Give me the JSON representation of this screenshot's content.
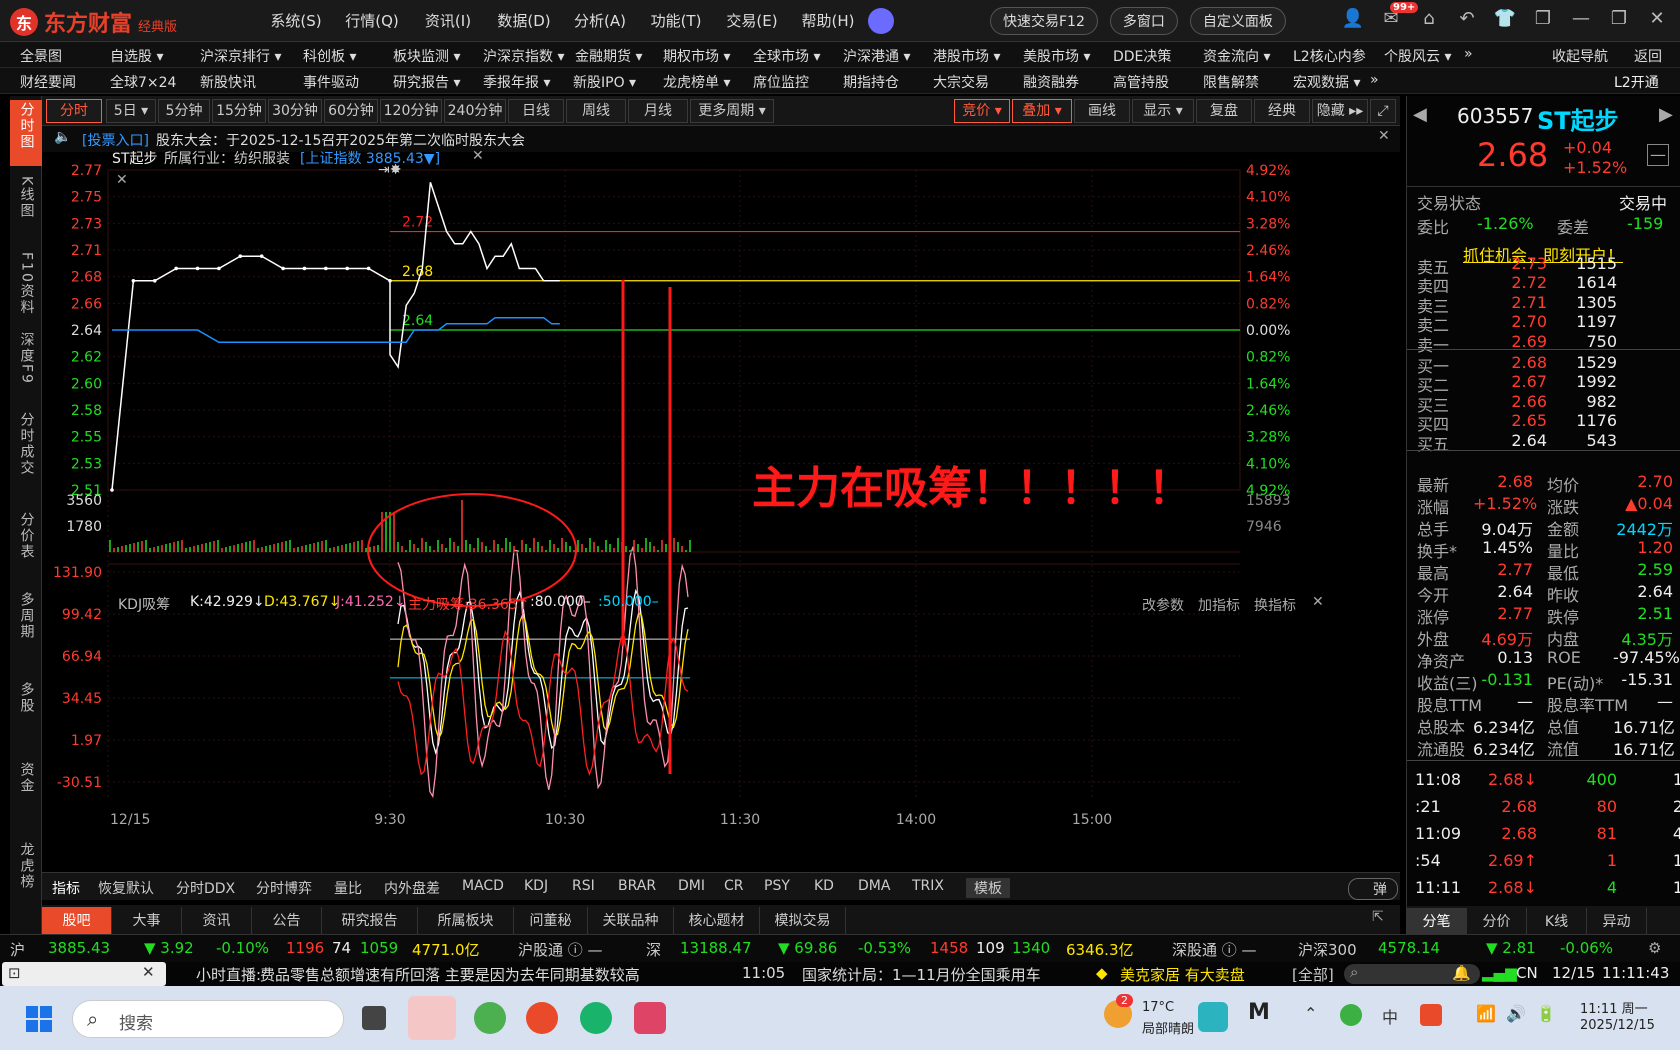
{
  "app": {
    "logo": "东方财富",
    "edition": "经典版"
  },
  "menu": [
    "系统(S)",
    "行情(Q)",
    "资讯(I)",
    "数据(D)",
    "分析(A)",
    "功能(T)",
    "交易(E)",
    "帮助(H)"
  ],
  "title_tools": [
    "快速交易F12",
    "多窗口",
    "自定义面板"
  ],
  "mail_badge": "99+",
  "nav1": [
    "全景图",
    "自选股 ▾",
    "沪深京排行 ▾",
    "科创板 ▾",
    "板块监测 ▾",
    "沪深京指数 ▾",
    "金融期货 ▾",
    "期权市场 ▾",
    "全球市场 ▾",
    "沪深港通 ▾",
    "港股市场 ▾",
    "美股市场 ▾",
    "DDE决策",
    "资金流向 ▾",
    "L2核心内参",
    "个股风云 ▾",
    "»",
    "收起导航",
    "返回"
  ],
  "nav2": [
    "财经要闻",
    "全球7×24",
    "新股快讯",
    "事件驱动",
    "研究报告 ▾",
    "季报年报 ▾",
    "新股IPO ▾",
    "龙虎榜单 ▾",
    "席位监控",
    "期指持仓",
    "大宗交易",
    "融资融券",
    "高管持股",
    "限售解禁",
    "宏观数据 ▾",
    "»",
    "L2开通"
  ],
  "leftbar": [
    "分时图",
    "K线图",
    "F10资料",
    "深度F9",
    "分时成交",
    "分价表",
    "多周期",
    "多股",
    "资金",
    "龙虎榜"
  ],
  "periods": [
    "分时",
    "5日 ▾",
    "5分钟",
    "15分钟",
    "30分钟",
    "60分钟",
    "120分钟",
    "240分钟",
    "日线",
    "周线",
    "月线",
    "更多周期 ▾"
  ],
  "chart_tools": [
    "竞价 ▾",
    "叠加 ▾",
    "画线",
    "显示 ▾",
    "复盘",
    "经典",
    "隐藏 ▸▸"
  ],
  "notice": {
    "link": "[投票入口]",
    "text": "股东大会：于2025-12-15召开2025年第二次临时股东大会"
  },
  "chart_head": {
    "name": "ST起步",
    "industry": "所属行业：纺织服装",
    "index": "[上证指数 3885.43▼]"
  },
  "kdj_head": {
    "name": "KDJ吸筹",
    "k": "K:42.929↓",
    "d": "D:43.767↓",
    "j": "J:41.252↓",
    "main": "主力吸筹:36.365↑",
    "l80": ":80.000–",
    "l50": ":50.000–"
  },
  "kdj_tools": [
    "改参数",
    "加指标",
    "换指标"
  ],
  "annotation": "主力在吸筹！！！！！",
  "chart_data": {
    "type": "line",
    "x_ticks": [
      "12/15",
      "9:30",
      "10:30",
      "11:30",
      "14:00",
      "15:00"
    ],
    "price_ticks": [
      "2.77",
      "2.75",
      "2.73",
      "2.71",
      "2.68",
      "2.66",
      "2.64",
      "2.62",
      "2.60",
      "2.58",
      "2.55",
      "2.53",
      "2.51"
    ],
    "pct_ticks": [
      "4.92%",
      "4.10%",
      "3.28%",
      "2.46%",
      "1.64%",
      "0.82%",
      "0.00%",
      "0.82%",
      "1.64%",
      "2.46%",
      "3.28%",
      "4.10%",
      "4.92%"
    ],
    "ylim": [
      2.51,
      2.77
    ],
    "prev_close": 2.64,
    "level_labels": [
      "2.72",
      "2.68",
      "2.64"
    ],
    "volume_ticks": [
      "3560",
      "1780"
    ],
    "volume_right": [
      "15893",
      "7946"
    ],
    "kdj_ticks": [
      "131.90",
      "99.42",
      "66.94",
      "34.45",
      "1.97",
      "-30.51"
    ],
    "series": [
      {
        "values": [
          2.51,
          2.68,
          2.68,
          2.69,
          2.69,
          2.69,
          2.7,
          2.7,
          2.69,
          2.69,
          2.69,
          2.69,
          2.69,
          2.68,
          2.62,
          2.61,
          2.66,
          2.67,
          2.69,
          2.76,
          2.74,
          2.72,
          2.71,
          2.71,
          2.72,
          2.71,
          2.69,
          2.7,
          2.7,
          2.71,
          2.69,
          2.69,
          2.69,
          2.68,
          2.68,
          2.68
        ]
      },
      {
        "values": [
          2.64,
          2.64,
          2.64,
          2.64,
          2.64,
          2.63,
          2.63,
          2.63,
          2.63,
          2.63,
          2.63,
          2.63,
          2.63,
          2.63,
          2.63,
          2.63,
          2.63,
          2.64,
          2.64,
          2.64,
          2.64,
          2.645,
          2.645,
          2.645,
          2.645,
          2.645,
          2.645,
          2.65,
          2.65,
          2.65,
          2.65,
          2.65,
          2.65,
          2.65,
          2.645,
          2.645
        ]
      }
    ]
  },
  "indicators": [
    "指标",
    "恢复默认",
    "分时DDX",
    "分时博弈",
    "量比",
    "内外盘差",
    "MACD",
    "KDJ",
    "RSI",
    "BRAR",
    "DMI",
    "CR",
    "PSY",
    "KD",
    "DMA",
    "TRIX",
    "模板"
  ],
  "popup_label": "弹",
  "bottom_tabs": [
    "股吧",
    "大事",
    "资讯",
    "公告",
    "研究报告",
    "所属板块",
    "问董秘",
    "关联品种",
    "核心题材",
    "模拟交易"
  ],
  "right_tabs": [
    "分笔",
    "分价",
    "K线",
    "异动"
  ],
  "quote": {
    "code": "603557",
    "name": "ST起步",
    "price": "2.68",
    "chg": "+0.04",
    "pct": "+1.52%",
    "status_label": "交易状态",
    "status": "交易中",
    "webi_label": "委比",
    "webi": "-1.26%",
    "weicha_label": "委差",
    "weicha": "-159",
    "promo": "抓住机会，即刻开户！",
    "asks": [
      [
        "卖五",
        "2.73",
        "1515"
      ],
      [
        "卖四",
        "2.72",
        "1614"
      ],
      [
        "卖三",
        "2.71",
        "1305"
      ],
      [
        "卖二",
        "2.70",
        "1197"
      ],
      [
        "卖一",
        "2.69",
        "750"
      ]
    ],
    "bids": [
      [
        "买一",
        "2.68",
        "1529"
      ],
      [
        "买二",
        "2.67",
        "1992"
      ],
      [
        "买三",
        "2.66",
        "982"
      ],
      [
        "买四",
        "2.65",
        "1176"
      ],
      [
        "买五",
        "2.64",
        "543"
      ]
    ],
    "stats": [
      [
        "最新",
        "2.68",
        "均价",
        "2.70"
      ],
      [
        "涨幅",
        "+1.52%",
        "涨跌",
        "▲0.04"
      ],
      [
        "总手",
        "9.04万",
        "金额",
        "2442万"
      ],
      [
        "换手*",
        "1.45%",
        "量比",
        "1.20"
      ],
      [
        "最高",
        "2.77",
        "最低",
        "2.59"
      ],
      [
        "今开",
        "2.64",
        "昨收",
        "2.64"
      ],
      [
        "涨停",
        "2.77",
        "跌停",
        "2.51"
      ],
      [
        "外盘",
        "4.69万",
        "内盘",
        "4.35万"
      ],
      [
        "净资产",
        "0.13",
        "ROE",
        "-97.45%"
      ],
      [
        "收益(三)",
        "-0.131",
        "PE(动)*",
        "-15.31"
      ],
      [
        "股息TTM",
        "—",
        "股息率TTM",
        "—"
      ],
      [
        "总股本",
        "6.234亿",
        "总值",
        "16.71亿"
      ],
      [
        "流通股",
        "6.234亿",
        "流值",
        "16.71亿"
      ]
    ],
    "ticks": [
      [
        "11:08",
        "2.68↓",
        "400",
        "1"
      ],
      [
        ":21",
        "2.68",
        "80",
        "2"
      ],
      [
        "11:09",
        "2.68",
        "81",
        "4"
      ],
      [
        ":54",
        "2.69↑",
        "1",
        "1"
      ],
      [
        "11:11",
        "2.68↓",
        "4",
        "1"
      ]
    ]
  },
  "ticker": {
    "sh": "沪",
    "sh_val": "3885.43",
    "sh_chg": "▼ 3.92",
    "sh_pct": "-0.10%",
    "sh_up": "1196",
    "sh_flat": "74",
    "sh_dn": "1059",
    "sh_amt": "4771.0亿",
    "hgt": "沪股通 ⓘ —",
    "sz": "深",
    "sz_val": "13188.47",
    "sz_chg": "▼ 69.86",
    "sz_pct": "-0.53%",
    "sz_up": "1458",
    "sz_flat": "109",
    "sz_dn": "1340",
    "sz_amt": "6346.3亿",
    "sgt": "深股通 ⓘ —",
    "hs300": "沪深300",
    "hs_val": "4578.14",
    "hs_chg": "▼ 2.81",
    "hs_pct": "-0.06%"
  },
  "news": {
    "prefix": "小时直播:",
    "text": "费品零售总额增速有所回落 主要是因为去年同期基数较高",
    "time": "11:05",
    "text2": "国家统计局：1—11月份全国乘用车",
    "hot": "美克家居  有大卖盘",
    "all": "[全部]",
    "cn": "CN",
    "date": "12/15",
    "clock": "11:11:43"
  },
  "taskbar": {
    "search": "搜索",
    "weather": "17°C",
    "weather_desc": "局部晴朗",
    "weather_badge": "2",
    "time": "11:11 周一",
    "date": "2025/12/15"
  }
}
